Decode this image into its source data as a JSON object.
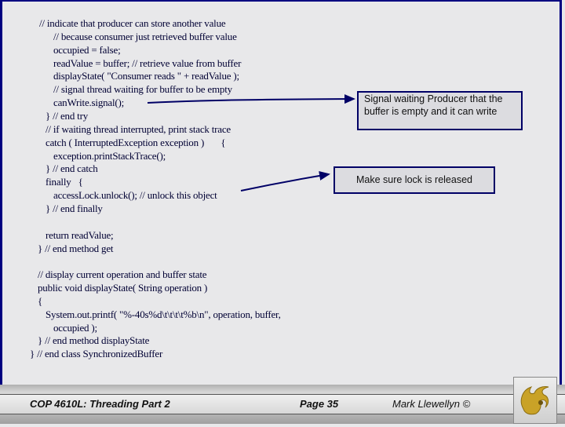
{
  "slide": {
    "code_lines": [
      "// indicate that producer can store another value",
      "// because consumer just retrieved buffer value",
      "occupied = false;",
      "readValue = buffer; // retrieve value from buffer",
      "displayState( \"Consumer reads \" + readValue );",
      "// signal thread waiting for buffer to be empty",
      "canWrite.signal();",
      "} // end try",
      "// if waiting thread interrupted, print stack trace",
      "catch ( InterruptedException exception )       {",
      "exception.printStackTrace();",
      "} // end catch",
      "finally   {",
      "accessLock.unlock(); // unlock this object",
      "} // end finally",
      "return readValue;",
      "} // end method get",
      "// display current operation and buffer state",
      "public void displayState( String operation )",
      "{",
      "System.out.printf( \"%-40s%d\\t\\t\\t\\t%b\\n\", operation, buffer,",
      "occupied );",
      "} // end method displayState",
      "} // end class SynchronizedBuffer"
    ],
    "callouts": {
      "signal": "Signal waiting Producer that the buffer is empty and it can write",
      "lock": "Make sure lock is released"
    }
  },
  "footer": {
    "course": "COP 4610L: Threading Part 2",
    "page": "Page 35",
    "author": "Mark Llewellyn ©"
  },
  "colors": {
    "border": "#000080",
    "logo_gold": "#c9a227"
  }
}
